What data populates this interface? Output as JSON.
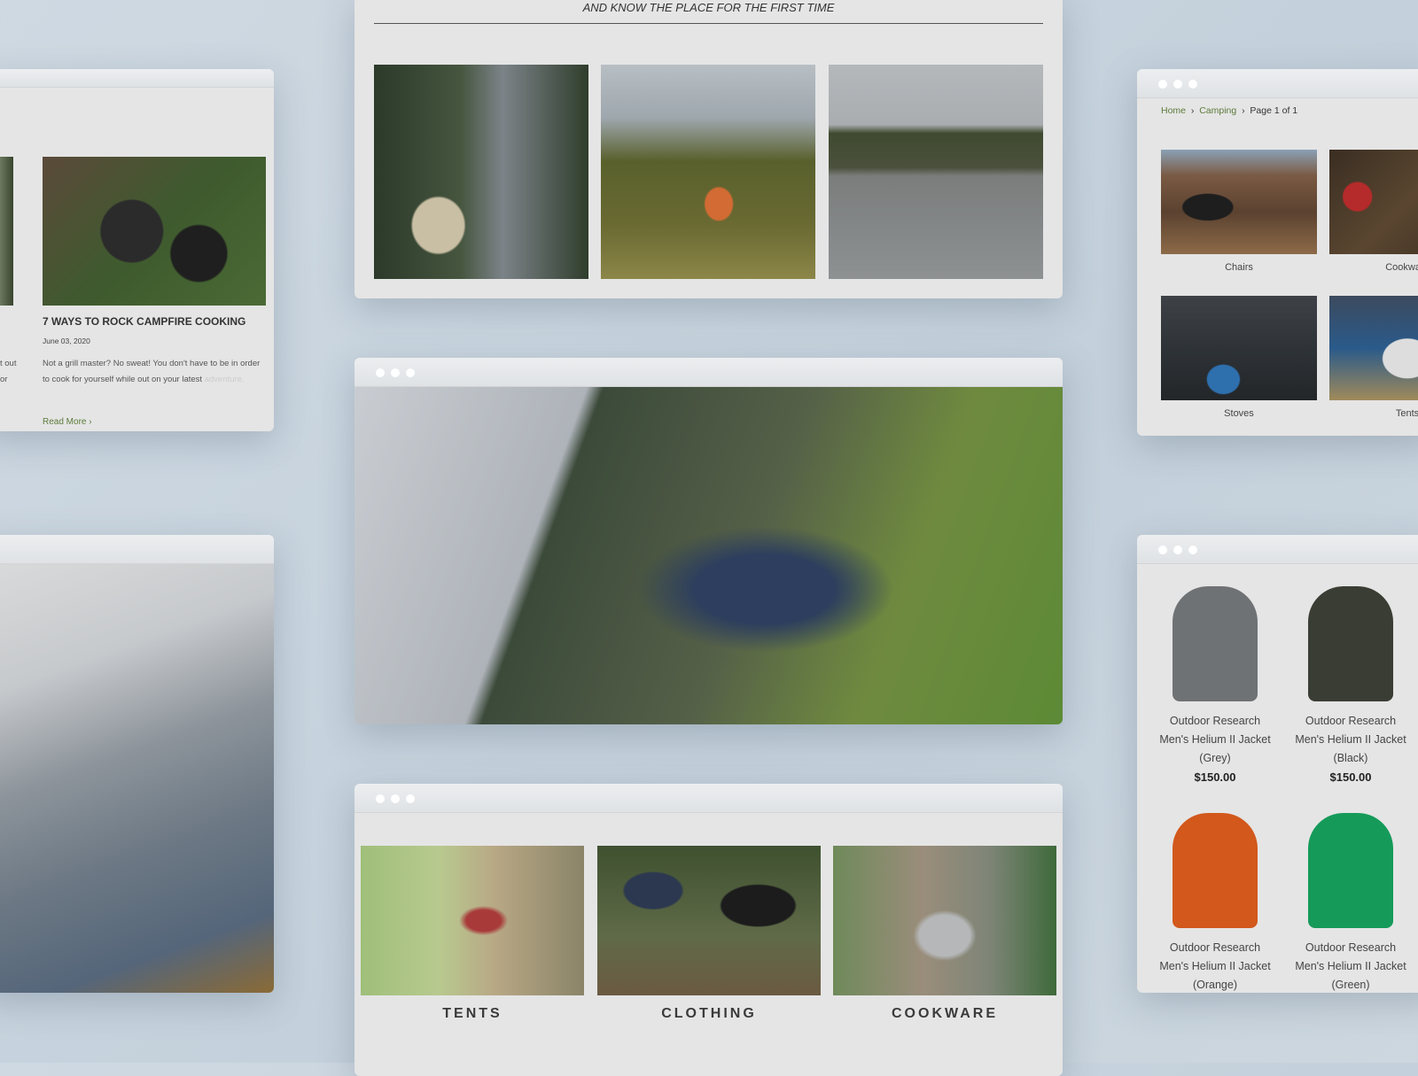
{
  "blog": {
    "title": "7 WAYS TO ROCK CAMPFIRE COOKING",
    "date": "June 03, 2020",
    "excerpt": "Not a grill master? No sweat! You don't have to be in order to cook for yourself while out on your latest",
    "excerpt_fade": "adventure.",
    "read_more": "Read More",
    "cut_line1": "t out",
    "cut_line2": "or"
  },
  "gallery": {
    "tagline": "AND KNOW THE PLACE FOR THE FIRST TIME"
  },
  "categories_card": {
    "items": [
      "TENTS",
      "CLOTHING",
      "COOKWARE"
    ]
  },
  "shop": {
    "breadcrumb": [
      "Home",
      "Camping",
      "Page 1 of 1"
    ],
    "items": [
      "Chairs",
      "Cookware",
      "Stoves",
      "Tents"
    ]
  },
  "products": {
    "items": [
      {
        "brand": "Outdoor Research",
        "name": "Men's Helium II Jacket",
        "variant": "(Grey)",
        "price": "$150.00",
        "color": "#6f7275"
      },
      {
        "brand": "Outdoor Research",
        "name": "Men's Helium II Jacket",
        "variant": "(Black)",
        "price": "$150.00",
        "color": "#3a3d33"
      },
      {
        "brand": "Outdoor Research",
        "name": "Men's Helium II Jacket",
        "variant": "(Orange)",
        "color": "#d2581c"
      },
      {
        "brand": "Outdoor Research",
        "name": "Men's Helium II Jacket",
        "variant": "(Green)",
        "color": "#159a5a"
      }
    ]
  },
  "colors": {
    "link_green": "#5c7a3a"
  }
}
